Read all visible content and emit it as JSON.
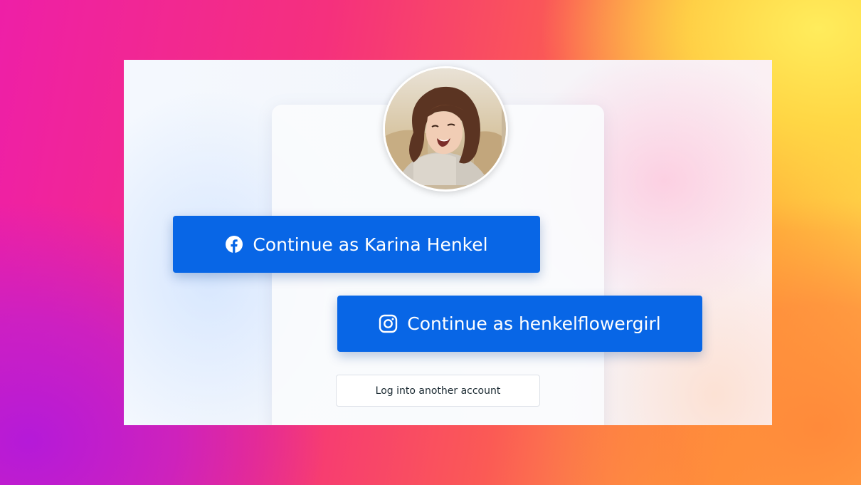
{
  "colors": {
    "button_primary": "#0866e6",
    "button_text": "#ffffff",
    "secondary_text": "#1c2b33"
  },
  "profile": {
    "avatar_description": "profile-photo"
  },
  "buttons": {
    "facebook": {
      "icon": "facebook-icon",
      "label": "Continue as Karina Henkel"
    },
    "instagram": {
      "icon": "instagram-icon",
      "label": "Continue as henkelflowergirl"
    },
    "another_account": {
      "label": "Log into another account"
    }
  }
}
